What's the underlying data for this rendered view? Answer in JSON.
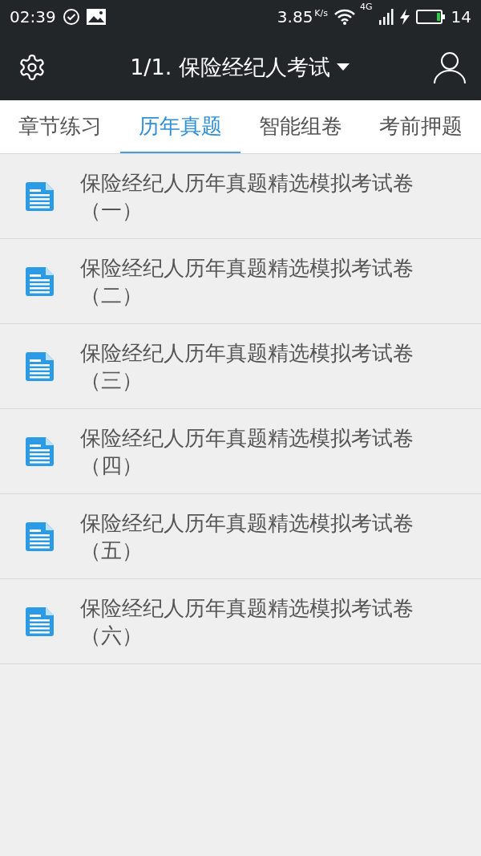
{
  "status_bar": {
    "time": "02:39",
    "speed": "3.85",
    "speed_unit": "K/s",
    "network": "4G",
    "battery": "14"
  },
  "header": {
    "title": "1/1. 保险经纪人考试"
  },
  "tabs": [
    {
      "label": "章节练习",
      "selected": false
    },
    {
      "label": "历年真题",
      "selected": true
    },
    {
      "label": "智能组卷",
      "selected": false
    },
    {
      "label": "考前押题",
      "selected": false
    }
  ],
  "papers": [
    {
      "title": "保险经纪人历年真题精选模拟考试卷（一）"
    },
    {
      "title": "保险经纪人历年真题精选模拟考试卷（二）"
    },
    {
      "title": "保险经纪人历年真题精选模拟考试卷（三）"
    },
    {
      "title": "保险经纪人历年真题精选模拟考试卷（四）"
    },
    {
      "title": "保险经纪人历年真题精选模拟考试卷（五）"
    },
    {
      "title": "保险经纪人历年真题精选模拟考试卷（六）"
    }
  ]
}
